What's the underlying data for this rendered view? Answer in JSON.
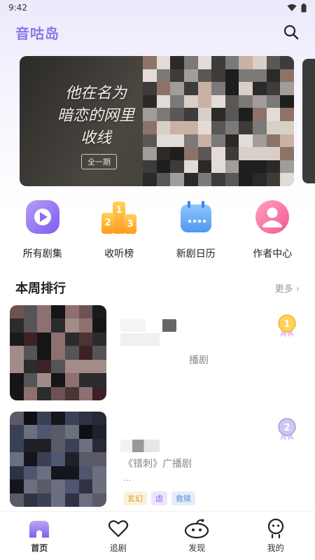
{
  "status_bar": {
    "time": "9:42"
  },
  "header": {
    "title": "音咕岛"
  },
  "banner": {
    "title_lines": [
      "他在名为",
      "暗恋的网里",
      "收线"
    ],
    "badge": "全一期"
  },
  "quick_nav": [
    {
      "label": "所有剧集",
      "icon": "play-icon"
    },
    {
      "label": "收听榜",
      "icon": "podium-icon"
    },
    {
      "label": "新剧日历",
      "icon": "calendar-icon"
    },
    {
      "label": "作者中心",
      "icon": "user-icon"
    }
  ],
  "weekly_ranking": {
    "title": "本周排行",
    "more": "更多",
    "items": [
      {
        "rank": "1",
        "subtitle_suffix": "播剧",
        "description": "",
        "tags": []
      },
      {
        "rank": "2",
        "subtitle_suffix": "《错刺》广播剧",
        "description": "...",
        "tags": [
          "玄幻",
          "虐",
          "救赎"
        ]
      }
    ]
  },
  "bottom_nav": [
    {
      "label": "首页",
      "icon": "home-icon",
      "active": true
    },
    {
      "label": "追剧",
      "icon": "heart-icon",
      "active": false
    },
    {
      "label": "发现",
      "icon": "discover-icon",
      "active": false
    },
    {
      "label": "我的",
      "icon": "profile-icon",
      "active": false
    }
  ],
  "colors": {
    "accent": "#8a78e6",
    "tag_xuanhuan_bg": "#fdf0d9",
    "tag_nue_bg": "#ece6fb",
    "tag_jiushu_bg": "#e3eefb"
  }
}
